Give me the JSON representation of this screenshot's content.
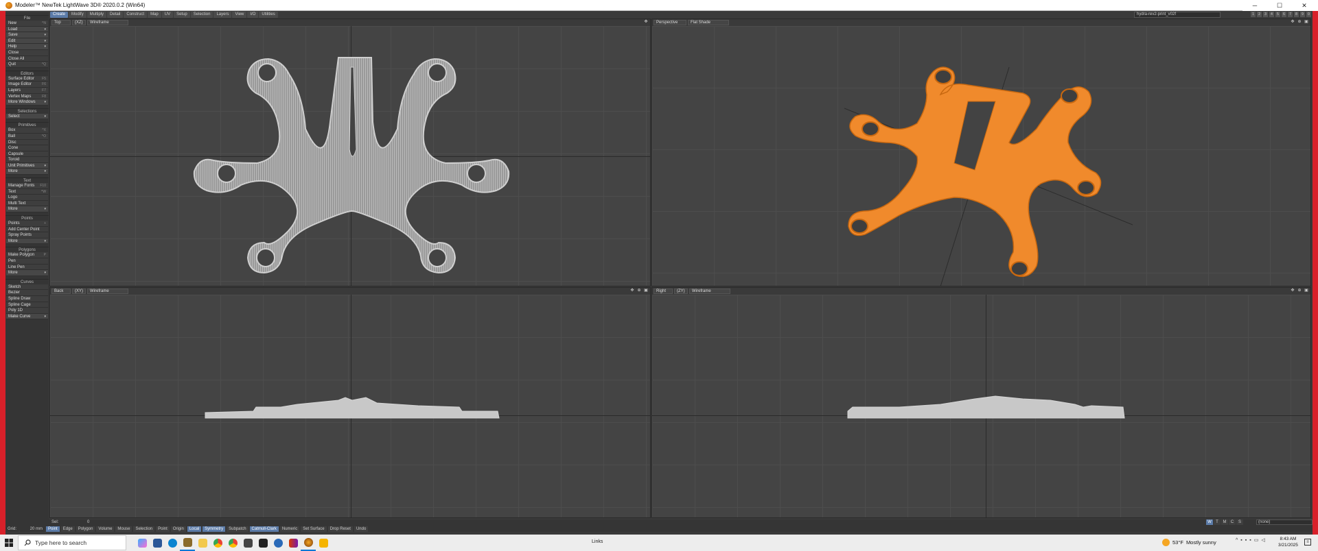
{
  "window": {
    "title": "Modeler™ NewTek LightWave 3D® 2020.0.2 (Win64)",
    "minimize": "─",
    "maximize": "☐",
    "close": "✕"
  },
  "menu_tabs": [
    "Create",
    "Modify",
    "Multiply",
    "Detail",
    "Construct",
    "Map",
    "UV",
    "Setup",
    "Selection",
    "Layers",
    "View",
    "I/O",
    "Utilities"
  ],
  "active_tab": "Create",
  "object_name": "hydra-rev2-print_v02f",
  "sidebar": {
    "file_title": "File",
    "file_items": [
      {
        "label": "New",
        "shortcut": "^N"
      },
      {
        "label": "Load",
        "shortcut": "▾"
      },
      {
        "label": "Save",
        "shortcut": "▾"
      },
      {
        "label": "Edit",
        "shortcut": "▾"
      },
      {
        "label": "Help",
        "shortcut": "▾"
      },
      {
        "label": "Close",
        "shortcut": ""
      },
      {
        "label": "Close All",
        "shortcut": ""
      },
      {
        "label": "Quit",
        "shortcut": "^Q"
      }
    ],
    "editors_title": "Editors",
    "editors_items": [
      {
        "label": "Surface Editor",
        "shortcut": "F5"
      },
      {
        "label": "Image Editor",
        "shortcut": "F6"
      },
      {
        "label": "Layers",
        "shortcut": "F7"
      },
      {
        "label": "Vertex Maps",
        "shortcut": "F8"
      },
      {
        "label": "More Windows",
        "shortcut": "▾"
      }
    ],
    "selections_title": "Selections",
    "selections_items": [
      {
        "label": "Select",
        "shortcut": "▾"
      }
    ],
    "primitives_title": "Primitives",
    "primitives_items": [
      {
        "label": "Box",
        "shortcut": "^X"
      },
      {
        "label": "Ball",
        "shortcut": "^O"
      },
      {
        "label": "Disc",
        "shortcut": ""
      },
      {
        "label": "Cone",
        "shortcut": ""
      },
      {
        "label": "Capsule",
        "shortcut": ""
      },
      {
        "label": "Toroid",
        "shortcut": ""
      },
      {
        "label": "Unit Primitives",
        "shortcut": "▾"
      },
      {
        "label": "More",
        "shortcut": "▾"
      }
    ],
    "text_title": "Text",
    "text_items": [
      {
        "label": "Manage Fonts",
        "shortcut": "F10"
      },
      {
        "label": "Text",
        "shortcut": "^W"
      },
      {
        "label": "Logo",
        "shortcut": ""
      },
      {
        "label": "Multi Text",
        "shortcut": ""
      },
      {
        "label": "More",
        "shortcut": "▾"
      }
    ],
    "points_title": "Points",
    "points_items": [
      {
        "label": "Points",
        "shortcut": "+"
      },
      {
        "label": "Add Center Point",
        "shortcut": ""
      },
      {
        "label": "Spray Points",
        "shortcut": ""
      },
      {
        "label": "More",
        "shortcut": "▾"
      }
    ],
    "polygons_title": "Polygons",
    "polygons_items": [
      {
        "label": "Make Polygon",
        "shortcut": "P"
      },
      {
        "label": "Pen",
        "shortcut": ""
      },
      {
        "label": "Line Pen",
        "shortcut": ""
      },
      {
        "label": "More",
        "shortcut": "▾"
      }
    ],
    "curves_title": "Curves",
    "curves_items": [
      {
        "label": "Sketch",
        "shortcut": ""
      },
      {
        "label": "Bezier",
        "shortcut": ""
      },
      {
        "label": "Spline Draw",
        "shortcut": ""
      },
      {
        "label": "Spline Cage",
        "shortcut": ""
      },
      {
        "label": "Poly 1D",
        "shortcut": ""
      },
      {
        "label": "Make Curve",
        "shortcut": "▾"
      }
    ]
  },
  "viewports": {
    "top": {
      "view": "Top",
      "axis": "(XZ)",
      "shade": "Wireframe"
    },
    "perspective": {
      "view": "Perspective",
      "shade": "Flat Shade"
    },
    "back": {
      "view": "Back",
      "axis": "(XY)",
      "shade": "Wireframe"
    },
    "right": {
      "view": "Right",
      "axis": "(ZY)",
      "shade": "Wireframe"
    }
  },
  "status": {
    "sel_label": "Sel:",
    "sel_value": "0",
    "grid_label": "Grid:",
    "grid_value": "20 mm"
  },
  "bottom_bar": [
    "Point",
    "Edge",
    "Polygon",
    "Volume",
    "Mouse",
    "Selection",
    "Point",
    "Origin",
    "Local",
    "Symmetry",
    "Subpatch",
    "Catmull-Clark",
    "Numeric",
    "Set Surface",
    "Drop Reset",
    "Undo"
  ],
  "mode_buttons": [
    "W",
    "T",
    "M",
    "C",
    "S"
  ],
  "mode_active": "W",
  "vmap_dropdown": "(none)",
  "taskbar": {
    "search_placeholder": "Type here to search",
    "links": "Links",
    "weather_temp": "53°F",
    "weather_desc": "Mostly sunny",
    "time": "8:43 AM",
    "date": "3/21/2025"
  },
  "colors": {
    "accent": "#5b7ba8",
    "frame_red": "#d8202a",
    "model_orange": "#f08a2c",
    "wire_gray": "#c8c8c8"
  }
}
